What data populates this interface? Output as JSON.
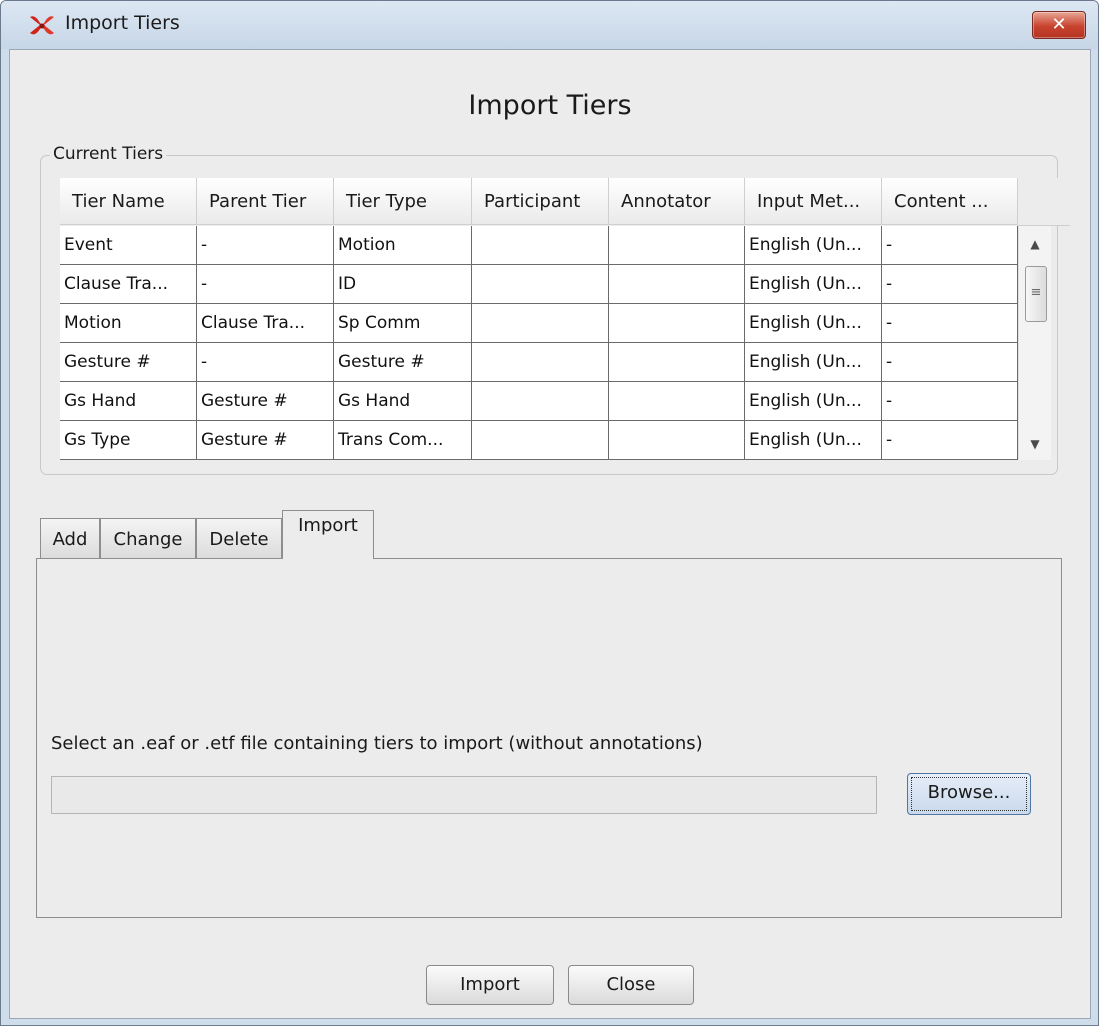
{
  "window": {
    "title": "Import Tiers",
    "close_glyph": "✕",
    "icon": "elan-app-icon"
  },
  "heading": "Import Tiers",
  "current_tiers": {
    "group_title": "Current Tiers",
    "columns": [
      "Tier Name",
      "Parent Tier",
      "Tier Type",
      "Participant",
      "Annotator",
      "Input Met...",
      "Content ..."
    ],
    "rows": [
      [
        "Event",
        "-",
        "Motion",
        "",
        "",
        "English (Un...",
        "-"
      ],
      [
        "Clause Tra...",
        "-",
        "ID",
        "",
        "",
        "English (Un...",
        "-"
      ],
      [
        "Motion",
        "Clause Tra...",
        "Sp Comm",
        "",
        "",
        "English (Un...",
        "-"
      ],
      [
        "Gesture #",
        "-",
        "Gesture #",
        "",
        "",
        "English (Un...",
        "-"
      ],
      [
        "Gs Hand",
        "Gesture #",
        "Gs Hand",
        "",
        "",
        "English (Un...",
        "-"
      ],
      [
        "Gs Type",
        "Gesture #",
        "Trans Com...",
        "",
        "",
        "English (Un...",
        "-"
      ]
    ],
    "scroll_up": "▲",
    "scroll_down": "▼",
    "thumb_grip": "≡"
  },
  "tabs": [
    {
      "label": "Add"
    },
    {
      "label": "Change"
    },
    {
      "label": "Delete"
    },
    {
      "label": "Import",
      "active": true
    }
  ],
  "import_panel": {
    "label": "Select an .eaf or .etf file containing tiers to import (without annotations)",
    "file_value": "",
    "browse_label": "Browse..."
  },
  "footer": {
    "import_label": "Import",
    "close_label": "Close"
  }
}
